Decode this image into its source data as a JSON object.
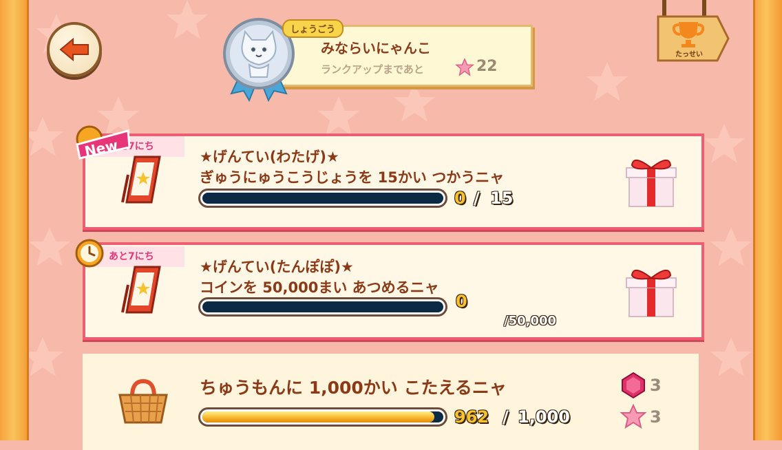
{
  "header": {
    "title_tag": "しょうごう",
    "title": "みならいにゃんこ",
    "rank_up_text": "ランクアップまであと",
    "rank_up_remaining": "22",
    "trophy_label": "たっせい"
  },
  "missions": [
    {
      "badge": "New",
      "deadline": "あと7にち",
      "title": "★げんてい(わたげ)★",
      "description": "ぎゅうにゅうこうじょうを 15かい つかうニャ",
      "current": "0",
      "separator": "/",
      "total": "15",
      "progress": 0,
      "reward": "gift-box-icon"
    },
    {
      "deadline": "あと7にち",
      "title": "★げんてい(たんぽぽ)★",
      "description": "コインを 50,000まい あつめるニャ",
      "current": "0",
      "total": "/50,000",
      "progress": 0,
      "reward": "gift-box-icon"
    },
    {
      "description": "ちゅうもんに 1,000かい こたえるニャ",
      "current": "962",
      "separator": "/",
      "total": "1,000",
      "progress": 0.962,
      "rewards": [
        {
          "icon": "gem-icon",
          "count": "3"
        },
        {
          "icon": "pink-star-icon",
          "count": "3"
        }
      ]
    }
  ],
  "colors": {
    "background": "#f7b9a9",
    "card_border": "#ee5e73",
    "bar_empty": "#0d2a45",
    "text_brown": "#8b3a18",
    "deadline_pink": "#e8357a"
  }
}
